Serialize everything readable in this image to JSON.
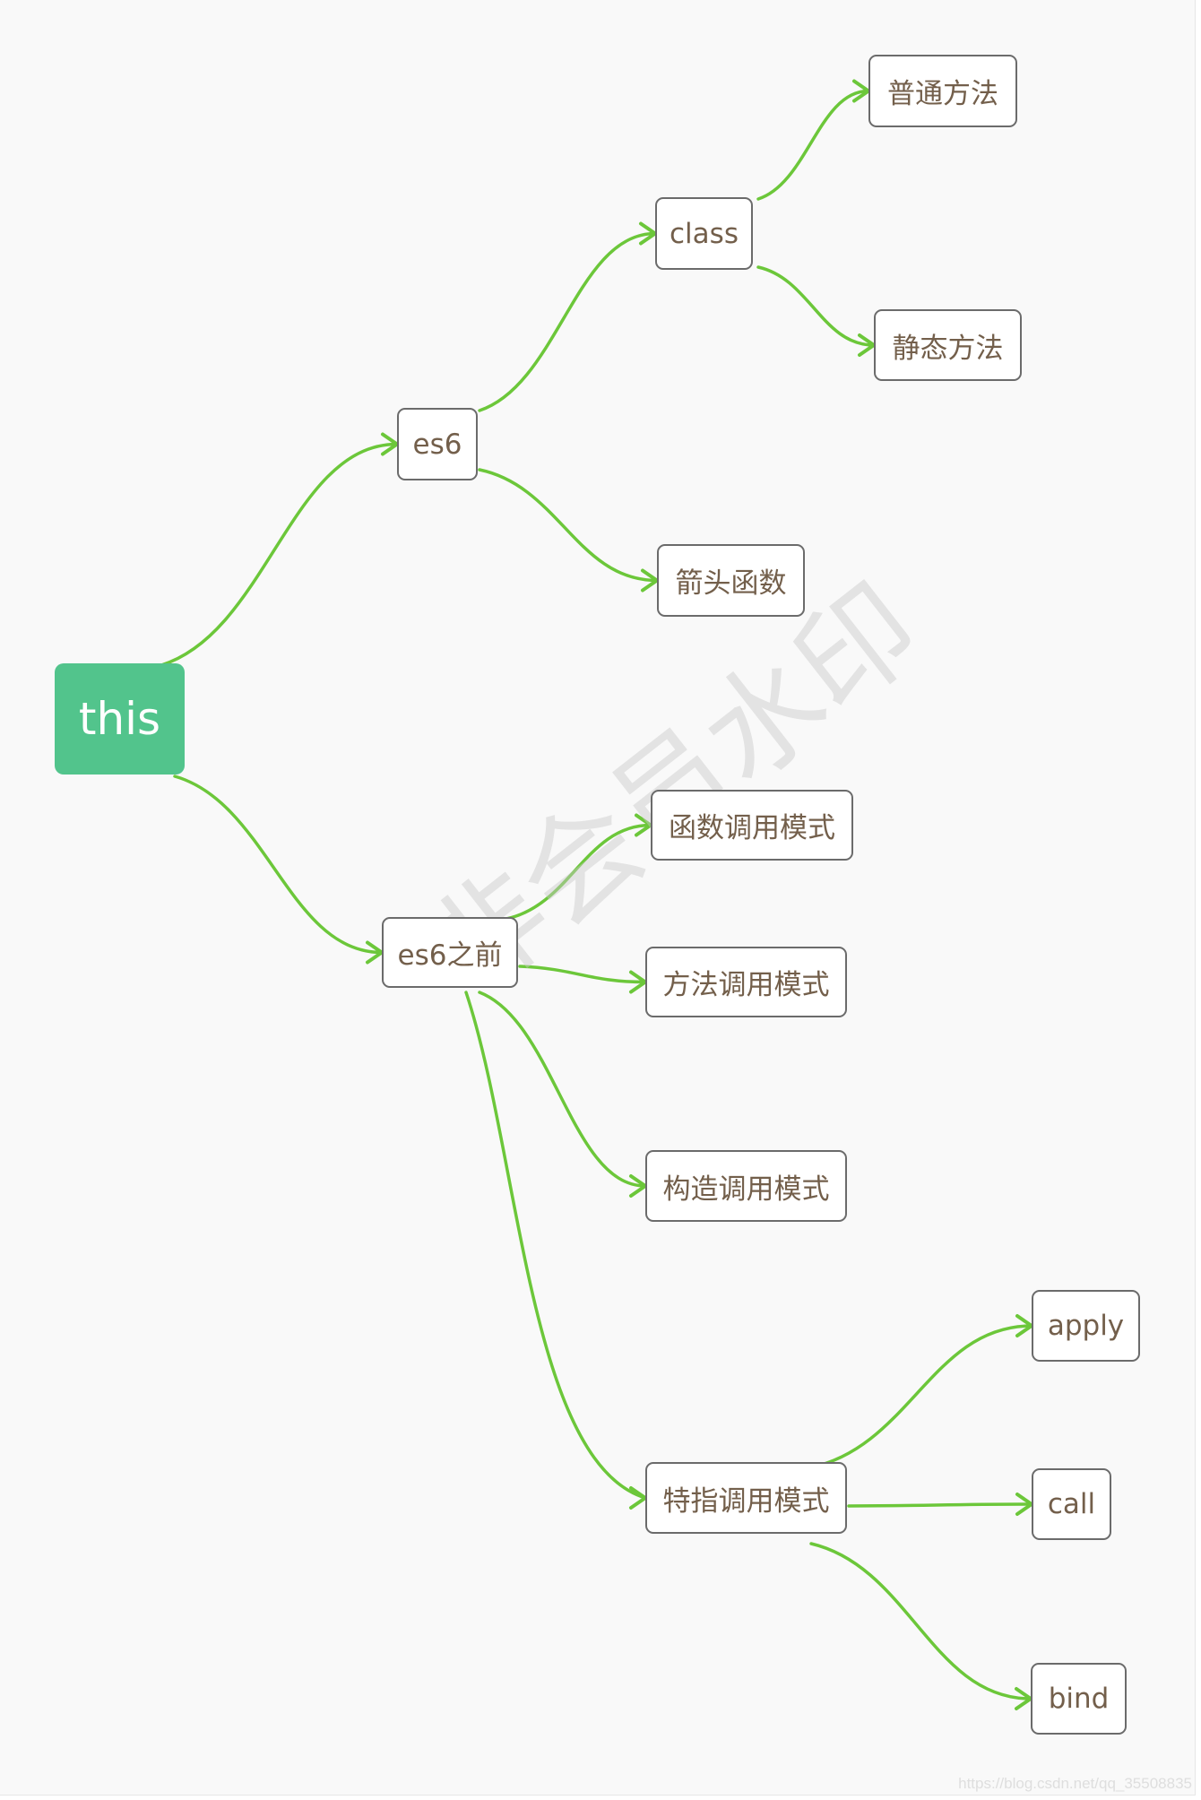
{
  "diagram": {
    "type": "mind-map",
    "root": "this",
    "nodes": [
      {
        "id": "this",
        "label": "this"
      },
      {
        "id": "es6",
        "label": "es6",
        "parent": "this"
      },
      {
        "id": "class",
        "label": "class",
        "parent": "es6"
      },
      {
        "id": "normal-method",
        "label": "普通方法",
        "parent": "class"
      },
      {
        "id": "static-method",
        "label": "静态方法",
        "parent": "class"
      },
      {
        "id": "arrow-function",
        "label": "箭头函数",
        "parent": "es6"
      },
      {
        "id": "before-es6",
        "label": "es6之前",
        "parent": "this"
      },
      {
        "id": "function-call",
        "label": "函数调用模式",
        "parent": "before-es6"
      },
      {
        "id": "method-call",
        "label": "方法调用模式",
        "parent": "before-es6"
      },
      {
        "id": "constructor-call",
        "label": "构造调用模式",
        "parent": "before-es6"
      },
      {
        "id": "explicit-call",
        "label": "特指调用模式",
        "parent": "before-es6"
      },
      {
        "id": "apply",
        "label": "apply",
        "parent": "explicit-call"
      },
      {
        "id": "call",
        "label": "call",
        "parent": "explicit-call"
      },
      {
        "id": "bind",
        "label": "bind",
        "parent": "explicit-call"
      }
    ],
    "colors": {
      "root_fill": "#52c48c",
      "edge": "#6cc73a",
      "node_text": "#735f4b",
      "node_border": "#6b6b6b",
      "background": "#f9f9f9"
    }
  },
  "watermark": {
    "center_text": "非会员水印",
    "url_text": "https://blog.csdn.net/qq_35508835"
  }
}
